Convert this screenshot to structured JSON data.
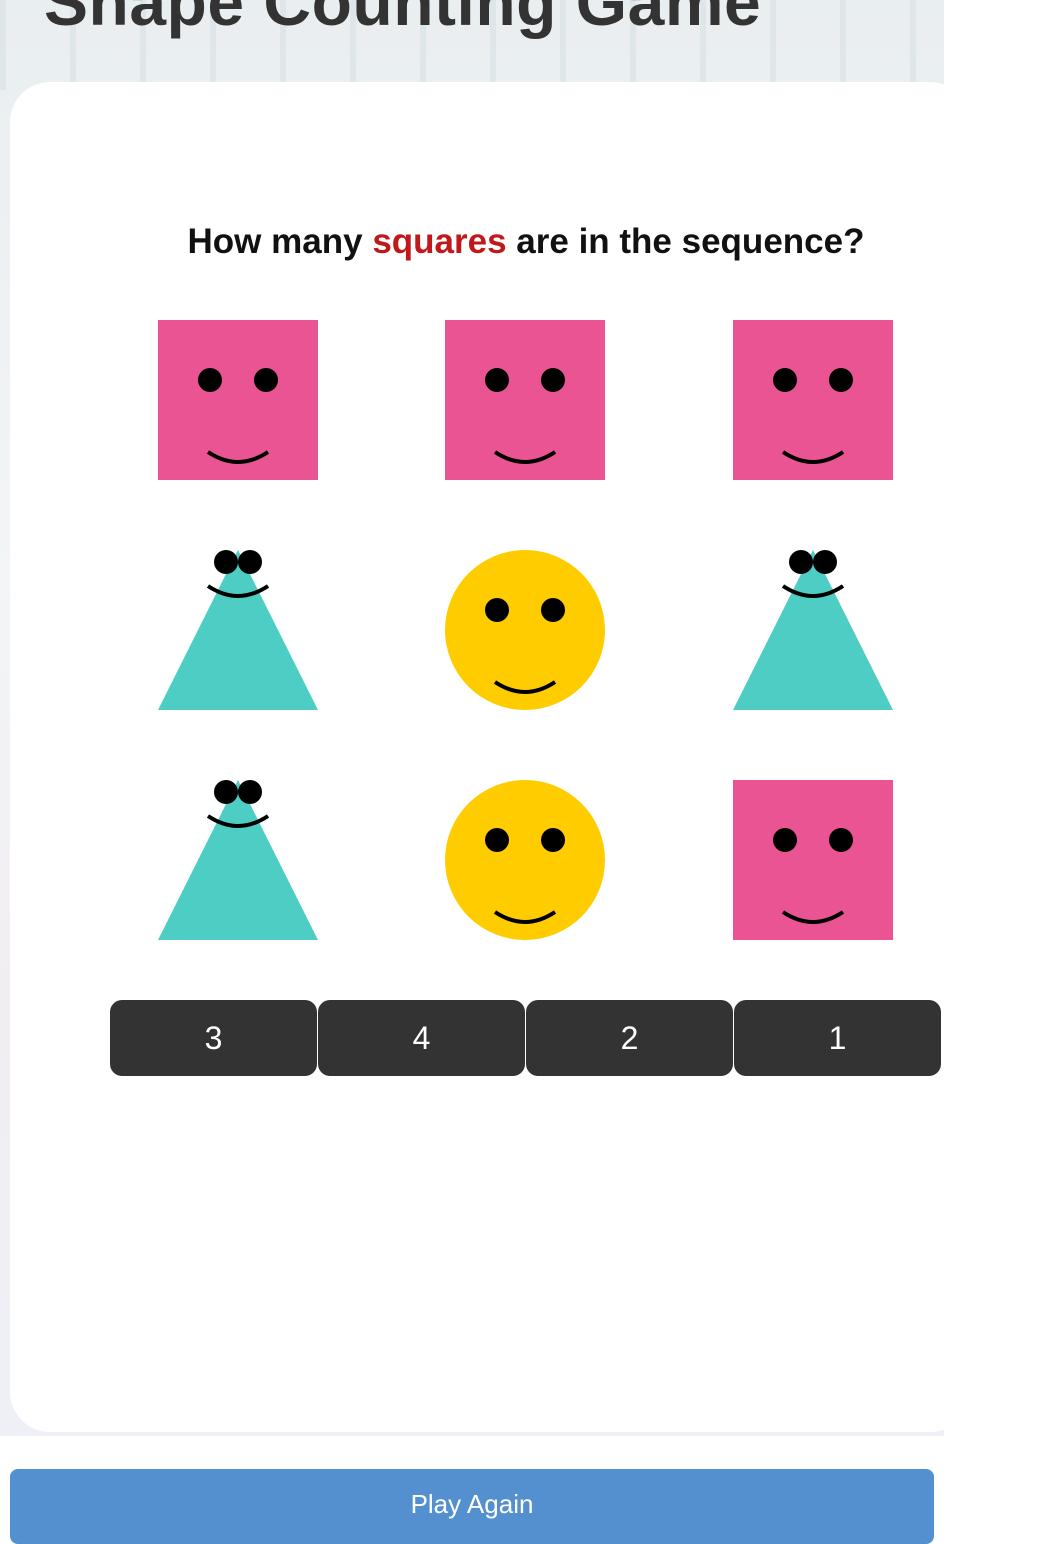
{
  "game": {
    "title": "Shape Counting Game",
    "question_prefix": "How many",
    "question_highlight": "squares",
    "question_suffix": "are in the sequence?",
    "highlight_color": "#c0191b"
  },
  "shapes": [
    [
      "square",
      "square",
      "square"
    ],
    [
      "triangle",
      "circle",
      "triangle"
    ],
    [
      "triangle",
      "circle",
      "square"
    ]
  ],
  "shape_colors": {
    "square": "#eb5492",
    "triangle": "#4ecdc4",
    "circle": "#ffcc00"
  },
  "answers": {
    "options": [
      "3",
      "4",
      "2",
      "1"
    ]
  },
  "footer": {
    "play_again_label": "Play Again",
    "play_again_color": "#5490cf"
  }
}
